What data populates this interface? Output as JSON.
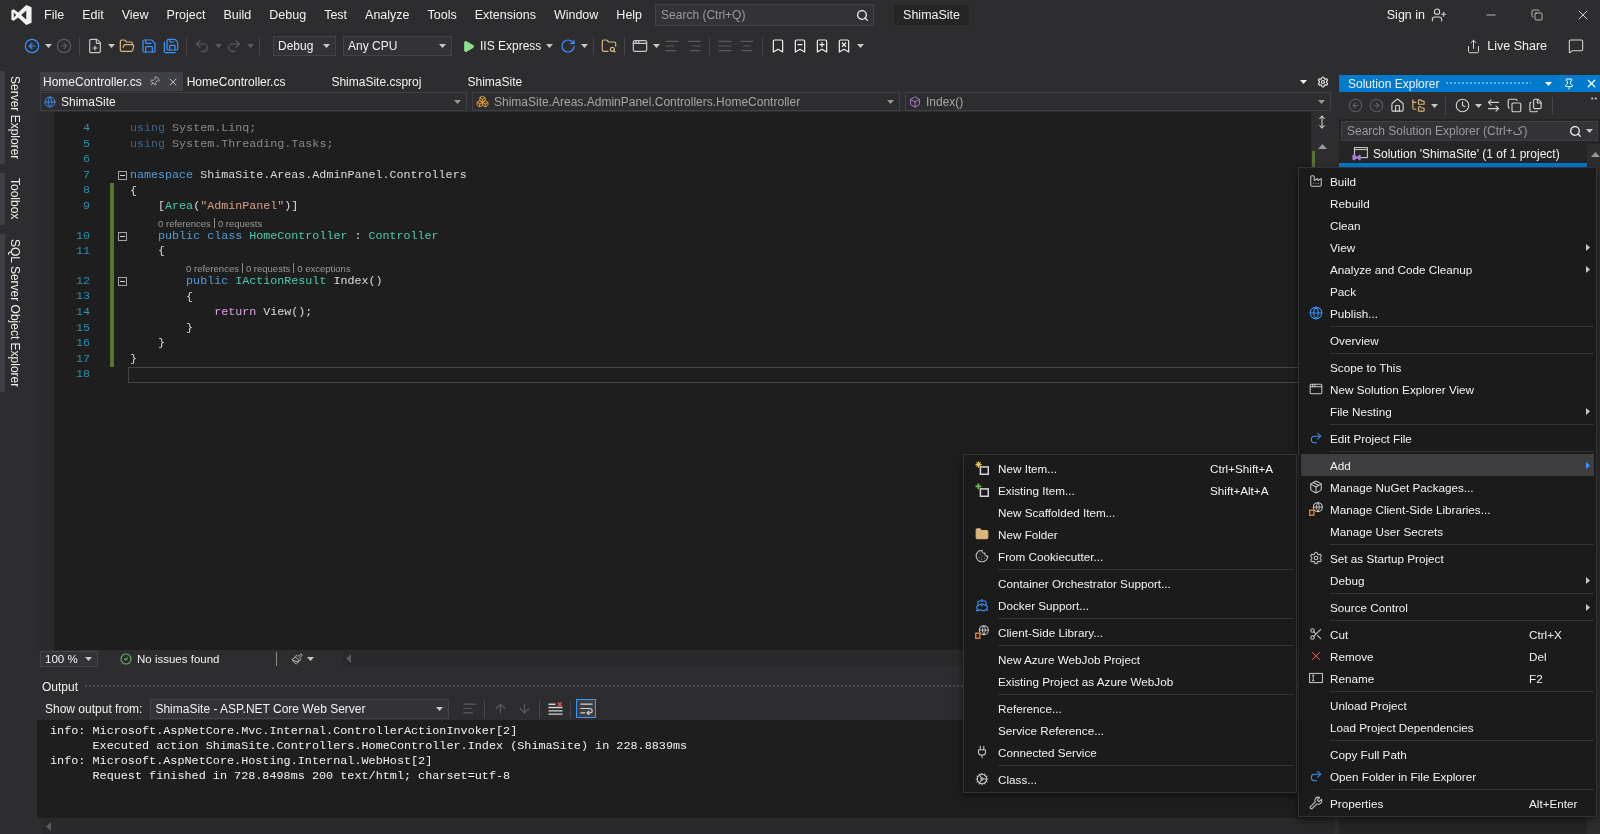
{
  "title_bar": {
    "menus": [
      "File",
      "Edit",
      "View",
      "Project",
      "Build",
      "Debug",
      "Test",
      "Analyze",
      "Tools",
      "Extensions",
      "Window",
      "Help"
    ],
    "search_placeholder": "Search (Ctrl+Q)",
    "solution_name": "ShimaSite",
    "sign_in": "Sign in"
  },
  "toolbar": {
    "items": [
      {
        "kind": "button",
        "disabled": false
      },
      {
        "kind": "caret",
        "disabled": false
      },
      {
        "kind": "button",
        "disabled": true
      },
      {
        "kind": "separator"
      },
      {
        "kind": "button",
        "disabled": false
      },
      {
        "kind": "caret",
        "disabled": false
      },
      {
        "kind": "button",
        "disabled": false
      },
      {
        "kind": "button",
        "disabled": false
      },
      {
        "kind": "button",
        "disabled": false
      },
      {
        "kind": "separator"
      },
      {
        "kind": "button",
        "disabled": true
      },
      {
        "kind": "caret",
        "disabled": true
      },
      {
        "kind": "button",
        "disabled": true
      },
      {
        "kind": "caret",
        "disabled": true
      },
      {
        "kind": "separator"
      },
      {
        "kind": "dropdown",
        "value": "Debug"
      },
      {
        "kind": "dropdown",
        "value": "Any CPU"
      },
      {
        "kind": "run",
        "label": "IIS Express"
      },
      {
        "kind": "button",
        "disabled": false
      },
      {
        "kind": "caret",
        "disabled": false
      },
      {
        "kind": "separator"
      },
      {
        "kind": "button",
        "disabled": false
      },
      {
        "kind": "separator"
      },
      {
        "kind": "button",
        "disabled": false
      },
      {
        "kind": "caret",
        "disabled": false
      },
      {
        "kind": "button",
        "disabled": true
      },
      {
        "kind": "button",
        "disabled": true
      },
      {
        "kind": "separator"
      },
      {
        "kind": "button",
        "disabled": true
      },
      {
        "kind": "button",
        "disabled": true
      },
      {
        "kind": "separator"
      },
      {
        "kind": "button",
        "disabled": false
      },
      {
        "kind": "button",
        "disabled": false
      },
      {
        "kind": "button",
        "disabled": false
      },
      {
        "kind": "button",
        "disabled": false
      },
      {
        "kind": "caret",
        "disabled": false
      }
    ],
    "live_share": "Live Share"
  },
  "side_tabs": [
    "Server Explorer",
    "Toolbox",
    "SQL Server Object Explorer"
  ],
  "document_tabs": [
    {
      "label": "HomeController.cs",
      "selected": true
    },
    {
      "label": "HomeController.cs",
      "selected": false
    },
    {
      "label": "ShimaSite.csproj",
      "selected": false
    },
    {
      "label": "ShimaSite",
      "selected": false
    }
  ],
  "navigation_bar": {
    "project": "ShimaSite",
    "type": "ShimaSite.Areas.AdminPanel.Controllers.HomeController",
    "member": "Index()"
  },
  "editor": {
    "lines": [
      {
        "number": "4",
        "tokens": [
          {
            "text": "using",
            "kind": "keyword"
          },
          {
            "text": " System.Linq;",
            "kind": "plain"
          }
        ],
        "faded": true,
        "changed": false,
        "current": false
      },
      {
        "number": "5",
        "tokens": [
          {
            "text": "using",
            "kind": "keyword"
          },
          {
            "text": " System.Threading.Tasks;",
            "kind": "plain"
          }
        ],
        "faded": true,
        "changed": false,
        "current": false
      },
      {
        "number": "6",
        "changed": false,
        "current": false
      },
      {
        "number": "7",
        "expanded": true,
        "tokens": [
          {
            "text": "namespace",
            "kind": "keyword"
          },
          {
            "text": " ShimaSite.Areas.AdminPanel.Controllers",
            "kind": "plain"
          }
        ],
        "faded": false,
        "changed": false,
        "current": false
      },
      {
        "number": "8",
        "tokens": [
          {
            "text": "{",
            "kind": "plain"
          }
        ],
        "faded": false,
        "changed": true,
        "current": false
      },
      {
        "number": "9",
        "tokens": [
          {
            "text": "    [",
            "kind": "plain"
          },
          {
            "text": "Area",
            "kind": "type"
          },
          {
            "text": "(",
            "kind": "plain"
          },
          {
            "text": "\"AdminPanel\"",
            "kind": "string"
          },
          {
            "text": ")]",
            "kind": "plain"
          }
        ],
        "faded": false,
        "changed": true,
        "current": false
      },
      {
        "number": "10",
        "codelens": [
          "0 references",
          "0 requests"
        ],
        "expanded": true,
        "tokens": [
          {
            "text": "    public class",
            "kind": "keyword"
          },
          {
            "text": " HomeController",
            "kind": "type"
          },
          {
            "text": " : ",
            "kind": "plain"
          },
          {
            "text": "Controller",
            "kind": "type"
          }
        ],
        "faded": false,
        "changed": true,
        "current": false
      },
      {
        "number": "11",
        "tokens": [
          {
            "text": "    {",
            "kind": "plain"
          }
        ],
        "faded": false,
        "changed": true,
        "current": false
      },
      {
        "number": "12",
        "codelens": [
          "0 references",
          "0 requests",
          "0 exceptions"
        ],
        "expanded": true,
        "tokens": [
          {
            "text": "        public",
            "kind": "keyword"
          },
          {
            "text": " IActionResult",
            "kind": "type"
          },
          {
            "text": " Index()",
            "kind": "plain"
          }
        ],
        "faded": false,
        "changed": true,
        "current": false
      },
      {
        "number": "13",
        "tokens": [
          {
            "text": "        {",
            "kind": "plain"
          }
        ],
        "faded": false,
        "changed": true,
        "current": false
      },
      {
        "number": "14",
        "tokens": [
          {
            "text": "            return",
            "kind": "control"
          },
          {
            "text": " View();",
            "kind": "plain"
          }
        ],
        "faded": false,
        "changed": true,
        "current": false
      },
      {
        "number": "15",
        "tokens": [
          {
            "text": "        }",
            "kind": "plain"
          }
        ],
        "faded": false,
        "changed": true,
        "current": false
      },
      {
        "number": "16",
        "tokens": [
          {
            "text": "    }",
            "kind": "plain"
          }
        ],
        "faded": false,
        "changed": true,
        "current": false
      },
      {
        "number": "17",
        "tokens": [
          {
            "text": "}",
            "kind": "plain"
          }
        ],
        "faded": false,
        "changed": true,
        "current": false
      },
      {
        "number": "18",
        "changed": false,
        "current": true
      }
    ],
    "zoom": "100 %",
    "issues": "No issues found"
  },
  "output": {
    "title": "Output",
    "source_label": "Show output from:",
    "source": "ShimaSite - ASP.NET Core Web Server",
    "tools": [
      {
        "kind": "button",
        "disabled": true,
        "on": false
      },
      {
        "kind": "separator"
      },
      {
        "kind": "button",
        "disabled": true,
        "on": false
      },
      {
        "kind": "button",
        "disabled": true,
        "on": false
      },
      {
        "kind": "separator"
      },
      {
        "kind": "button",
        "disabled": false,
        "on": false
      },
      {
        "kind": "separator"
      },
      {
        "kind": "button",
        "disabled": false,
        "on": true
      }
    ],
    "lines": [
      {
        "label": "info:",
        "text": "Microsoft.AspNetCore.Mvc.Internal.ControllerActionInvoker[2]"
      },
      {
        "text": "Executed action ShimaSite.Controllers.HomeController.Index (ShimaSite) in 228.8839ms"
      },
      {
        "label": "info:",
        "text": "Microsoft.AspNetCore.Hosting.Internal.WebHost[2]"
      },
      {
        "text": "Request finished in 728.8498ms 200 text/html; charset=utf-8"
      }
    ]
  },
  "solution_explorer": {
    "title": "Solution Explorer",
    "tools": [
      {
        "kind": "button",
        "disabled": true
      },
      {
        "kind": "button",
        "disabled": true
      },
      {
        "kind": "button",
        "disabled": false
      },
      {
        "kind": "button",
        "disabled": false
      },
      {
        "kind": "caret",
        "disabled": false
      },
      {
        "kind": "separator"
      },
      {
        "kind": "button",
        "disabled": false
      },
      {
        "kind": "caret",
        "disabled": false
      },
      {
        "kind": "button",
        "disabled": false
      },
      {
        "kind": "button",
        "disabled": false
      },
      {
        "kind": "button",
        "disabled": false
      },
      {
        "kind": "separator"
      }
    ],
    "search_placeholder": "Search Solution Explorer (Ctrl+ک)",
    "tree": [
      {
        "label": "Solution 'ShimaSite' (1 of 1 project)",
        "selected": false,
        "children": [
          {
            "selected": true
          }
        ]
      }
    ]
  },
  "context_menu": {
    "groups": [
      [
        {
          "label": "Build",
          "submenu": false,
          "selected": false
        },
        {
          "label": "Rebuild",
          "submenu": false,
          "selected": false
        },
        {
          "label": "Clean",
          "submenu": false,
          "selected": false
        },
        {
          "label": "View",
          "submenu": true,
          "selected": false
        },
        {
          "label": "Analyze and Code Cleanup",
          "submenu": true,
          "selected": false
        },
        {
          "label": "Pack",
          "submenu": false,
          "selected": false
        },
        {
          "label": "Publish...",
          "submenu": false,
          "selected": false
        }
      ],
      [
        {
          "label": "Overview",
          "submenu": false,
          "selected": false
        }
      ],
      [
        {
          "label": "Scope to This",
          "submenu": false,
          "selected": false
        },
        {
          "label": "New Solution Explorer View",
          "submenu": false,
          "selected": false
        },
        {
          "label": "File Nesting",
          "submenu": true,
          "selected": false
        }
      ],
      [
        {
          "label": "Edit Project File",
          "submenu": false,
          "selected": false
        }
      ],
      [
        {
          "label": "Add",
          "submenu": true,
          "selected": true
        },
        {
          "label": "Manage NuGet Packages...",
          "submenu": false,
          "selected": false
        },
        {
          "label": "Manage Client-Side Libraries...",
          "submenu": false,
          "selected": false
        },
        {
          "label": "Manage User Secrets",
          "submenu": false,
          "selected": false
        }
      ],
      [
        {
          "label": "Set as Startup Project",
          "submenu": false,
          "selected": false
        },
        {
          "label": "Debug",
          "submenu": true,
          "selected": false
        }
      ],
      [
        {
          "label": "Source Control",
          "submenu": true,
          "selected": false
        }
      ],
      [
        {
          "label": "Cut",
          "shortcut": "Ctrl+X",
          "submenu": false,
          "selected": false
        },
        {
          "label": "Remove",
          "shortcut": "Del",
          "submenu": false,
          "selected": false
        },
        {
          "label": "Rename",
          "shortcut": "F2",
          "submenu": false,
          "selected": false
        }
      ],
      [
        {
          "label": "Unload Project",
          "submenu": false,
          "selected": false
        },
        {
          "label": "Load Project Dependencies",
          "submenu": false,
          "selected": false
        }
      ],
      [
        {
          "label": "Copy Full Path",
          "submenu": false,
          "selected": false
        },
        {
          "label": "Open Folder in File Explorer",
          "submenu": false,
          "selected": false
        }
      ],
      [
        {
          "label": "Properties",
          "shortcut": "Alt+Enter",
          "submenu": false,
          "selected": false
        }
      ]
    ]
  },
  "add_submenu": {
    "groups": [
      [
        {
          "label": "New Item...",
          "shortcut": "Ctrl+Shift+A",
          "submenu": false,
          "selected": false
        },
        {
          "label": "Existing Item...",
          "shortcut": "Shift+Alt+A",
          "submenu": false,
          "selected": false
        },
        {
          "label": "New Scaffolded Item...",
          "submenu": false,
          "selected": false
        },
        {
          "label": "New Folder",
          "submenu": false,
          "selected": false
        },
        {
          "label": "From Cookiecutter...",
          "submenu": false,
          "selected": false
        }
      ],
      [
        {
          "label": "Container Orchestrator Support...",
          "submenu": false,
          "selected": false
        },
        {
          "label": "Docker Support...",
          "submenu": false,
          "selected": false
        }
      ],
      [
        {
          "label": "Client-Side Library...",
          "submenu": false,
          "selected": false
        }
      ],
      [
        {
          "label": "New Azure WebJob Project",
          "submenu": false,
          "selected": false
        },
        {
          "label": "Existing Project as Azure WebJob",
          "submenu": false,
          "selected": false
        }
      ],
      [
        {
          "label": "Reference...",
          "submenu": false,
          "selected": false
        },
        {
          "label": "Service Reference...",
          "submenu": false,
          "selected": false
        },
        {
          "label": "Connected Service",
          "submenu": false,
          "selected": false
        }
      ],
      [
        {
          "label": "Class...",
          "submenu": false,
          "selected": false
        }
      ]
    ]
  }
}
